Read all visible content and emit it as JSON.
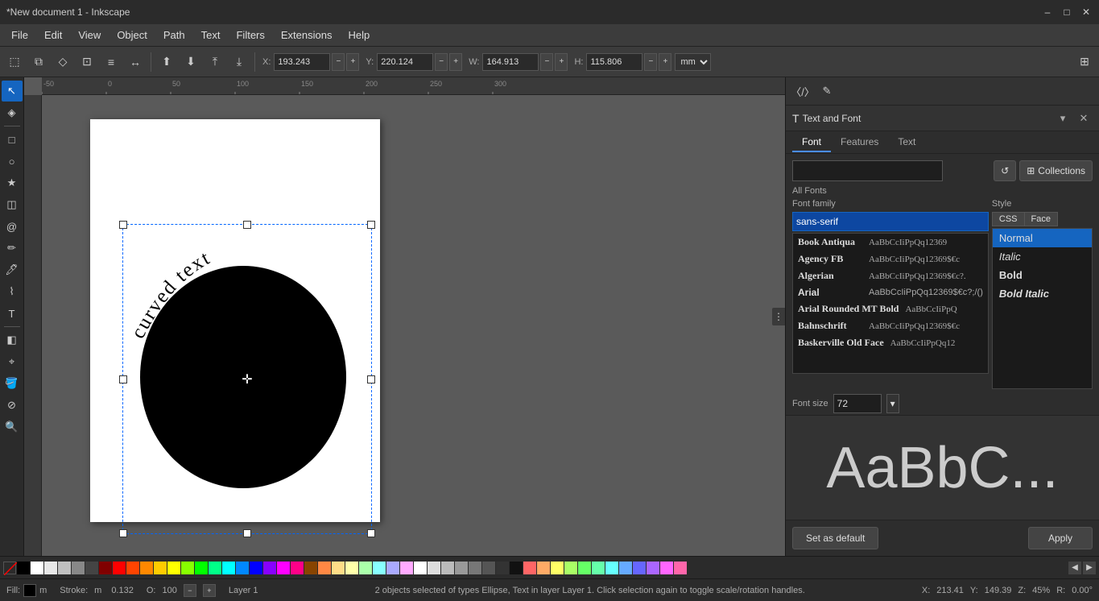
{
  "titlebar": {
    "title": "*New document 1 - Inkscape",
    "min_btn": "–",
    "max_btn": "□",
    "close_btn": "✕"
  },
  "menubar": {
    "items": [
      "File",
      "Edit",
      "View",
      "Object",
      "Path",
      "Text",
      "Filters",
      "Extensions",
      "Help"
    ]
  },
  "toolbar": {
    "coords": {
      "x_label": "X:",
      "x_value": "193.243",
      "y_label": "Y:",
      "y_value": "220.124",
      "w_label": "W:",
      "w_value": "164.913",
      "h_label": "H:",
      "h_value": "115.806",
      "unit": "mm"
    }
  },
  "panel": {
    "title": "Text and Font",
    "close_label": "✕",
    "expand_label": "▾",
    "sub_tabs": [
      "Font",
      "Features",
      "Text"
    ],
    "active_sub_tab": "Font",
    "search_placeholder": "",
    "refresh_label": "↺",
    "collections_label": "Collections",
    "all_fonts_label": "All Fonts",
    "font_family_col_label": "Font family",
    "style_col_label": "Style",
    "css_btn": "CSS",
    "face_btn": "Face",
    "font_input_value": "sans-serif",
    "font_preview_text": "AaBbCcIiPpQq12369$€c?",
    "fonts": [
      {
        "name": "Book Antiqua",
        "preview": "AaBbCcIiPpQq12369"
      },
      {
        "name": "Agency FB",
        "preview": "AaBbCcIiPpQq12369$€c"
      },
      {
        "name": "Algerian",
        "preview": "AaBbCcIiPpQq12369$€c?."
      },
      {
        "name": "Arial",
        "preview": "AaBbCcIiPpQq12369$€c?;/()"
      },
      {
        "name": "Arial Rounded MT Bold",
        "preview": "AaBbCcIiPpQ"
      },
      {
        "name": "Bahnschrift",
        "preview": "AaBbCcIiPpQq12369$€c"
      },
      {
        "name": "Baskerville Old Face",
        "preview": "AaBbCcIiPpQq12"
      }
    ],
    "styles": [
      "Normal",
      "Italic",
      "Bold",
      "Bold Italic"
    ],
    "active_style": "Normal",
    "font_size_label": "Font size",
    "font_size_value": "72",
    "large_preview_text": "AaBbC...",
    "set_default_label": "Set as default",
    "apply_label": "Apply"
  },
  "statusbar": {
    "fill_label": "Fill:",
    "fill_color": "#000000",
    "stroke_label": "Stroke:",
    "stroke_value": "m",
    "stroke_width": "0.132",
    "opacity_label": "O:",
    "opacity_value": "100",
    "status_message": "2 objects selected of types Ellipse, Text in layer Layer 1. Click selection again to toggle scale/rotation handles.",
    "layer": "Layer 1",
    "x_label": "X:",
    "x_value": "213.41",
    "y_label": "Y:",
    "y_value": "149.39",
    "zoom_label": "Z:",
    "zoom_value": "45%",
    "rotation_label": "R:",
    "rotation_value": "0.00°"
  },
  "palette": {
    "colors": [
      "#000000",
      "transparent",
      "#ffffff",
      "#e8e8e8",
      "#c0c0c0",
      "#888888",
      "#444444",
      "#800000",
      "#ff0000",
      "#ff4400",
      "#ff8800",
      "#ffcc00",
      "#ffff00",
      "#88ff00",
      "#00ff00",
      "#00ff88",
      "#00ffff",
      "#0088ff",
      "#0000ff",
      "#8800ff",
      "#ff00ff",
      "#ff0088",
      "#884400",
      "#ff8844",
      "#ffdd88",
      "#ffffaa",
      "#aaffaa",
      "#88ffff",
      "#aaaaff",
      "#ffaaff",
      "#ffffff",
      "#dddddd",
      "#bbbbbb",
      "#999999",
      "#777777",
      "#555555",
      "#333333",
      "#111111",
      "#ff6666",
      "#ffaa66",
      "#ffff66",
      "#aaff66",
      "#66ff66",
      "#66ffaa",
      "#66ffff",
      "#66aaff",
      "#6666ff",
      "#aa66ff",
      "#ff66ff",
      "#ff66aa"
    ]
  },
  "canvas": {
    "curved_text": "curved text"
  }
}
